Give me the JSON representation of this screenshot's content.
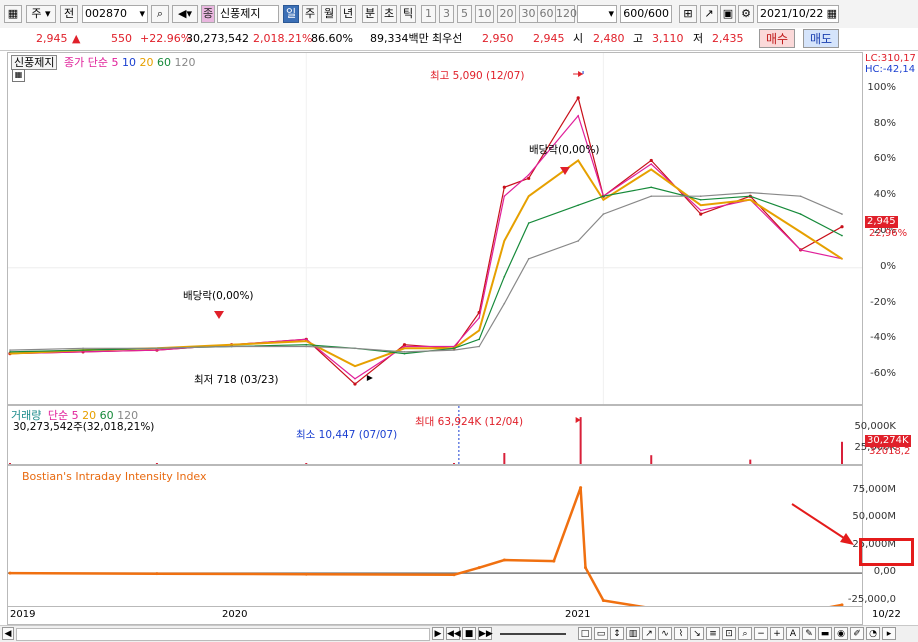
{
  "toolbar": {
    "market_label": "주",
    "prev_label": "전",
    "code": "002870",
    "stock_name": "신풍제지",
    "period_buttons": [
      "일",
      "주",
      "월",
      "년",
      "분",
      "초",
      "틱"
    ],
    "minute_buttons": [
      "1",
      "3",
      "5",
      "10",
      "20",
      "30",
      "60",
      "120"
    ],
    "count_display": "600",
    "count_total": "/600",
    "date": "2021/10/22"
  },
  "quote": {
    "price": "2,945",
    "change_arrow": "▲",
    "change": "550",
    "change_pct": "+22.96%",
    "volume": "30,273,542",
    "volume_pct": "2,018.21%",
    "ratio": "86.60%",
    "amount": "89,334백만",
    "best_label": "최우선",
    "best_ask": "2,950",
    "best_bid": "2,945",
    "open_label": "시",
    "open": "2,480",
    "high_label": "고",
    "high": "3,110",
    "low_label": "저",
    "low": "2,435",
    "buy_label": "매수",
    "sell_label": "매도"
  },
  "price_panel": {
    "title": "신풍제지",
    "legend_prefix": "종가 단순",
    "ma_labels": [
      "5",
      "10",
      "20",
      "60",
      "120"
    ],
    "ma_colors": [
      "#e0209a",
      "#1a3fd0",
      "#e6a000",
      "#168a3a",
      "#888888"
    ],
    "lc_label": "LC:310,17",
    "hc_label": "HC:-42,14",
    "y_ticks": [
      "100%",
      "80%",
      "60%",
      "40%",
      "20%",
      "0%",
      "-20%",
      "-40%",
      "-60%"
    ],
    "price_tag": "2,945",
    "pct_tag": "22,96%",
    "high_annotation": "최고 5,090 (12/07)",
    "low_annotation": "최저 718 (03/23)",
    "dividend1": "배당락(0,00%)",
    "dividend2": "배당락(0,00%)"
  },
  "volume_panel": {
    "title": "거래량",
    "legend_prefix": "단순",
    "ma_labels": [
      "5",
      "20",
      "60",
      "120"
    ],
    "current": "30,273,542주(32,018,21%)",
    "min_annotation": "최소 10,447 (07/07)",
    "max_annotation": "최대 63,924K (12/04)",
    "y_ticks": [
      "50,000K",
      "25,000K"
    ],
    "tag1": "30,274K",
    "tag2": "32018,2"
  },
  "bostian_panel": {
    "title": "Bostian's Intraday Intensity Index",
    "y_ticks": [
      "75,000M",
      "50,000M",
      "25,000M",
      "0,00",
      "-25,000,0"
    ],
    "highlight_value": "0,00"
  },
  "x_axis": {
    "labels": [
      "2019",
      "2020",
      "2021"
    ],
    "end_label": "10/22"
  },
  "chart_data": [
    {
      "type": "line",
      "title": "신풍제지",
      "xlabel": "",
      "ylabel": "",
      "y_unit": "%",
      "ylim": [
        -70,
        110
      ],
      "x": [
        "2019-01",
        "2019-04",
        "2019-07",
        "2019-10",
        "2020-01",
        "2020-03",
        "2020-05",
        "2020-07",
        "2020-08",
        "2020-09",
        "2020-10",
        "2020-12",
        "2021-01",
        "2021-03",
        "2021-05",
        "2021-07",
        "2021-09",
        "2021-10-22"
      ],
      "series": [
        {
          "name": "종가",
          "values": [
            -48,
            -47,
            -46,
            -43,
            -40,
            -65,
            -43,
            -45,
            -25,
            45,
            50,
            95,
            40,
            60,
            30,
            40,
            10,
            22.96
          ]
        },
        {
          "name": "5",
          "values": [
            -48,
            -47,
            -46,
            -43,
            -40,
            -62,
            -44,
            -44,
            -28,
            40,
            52,
            85,
            40,
            58,
            32,
            38,
            10,
            5
          ]
        },
        {
          "name": "20",
          "values": [
            -48,
            -46,
            -45,
            -43,
            -41,
            -55,
            -45,
            -45,
            -35,
            15,
            40,
            60,
            38,
            55,
            35,
            38,
            20,
            5
          ]
        },
        {
          "name": "60",
          "values": [
            -47,
            -46,
            -45,
            -44,
            -43,
            -45,
            -48,
            -45,
            -40,
            -5,
            25,
            35,
            40,
            45,
            38,
            40,
            30,
            18
          ]
        },
        {
          "name": "120",
          "values": [
            -46,
            -45,
            -45,
            -44,
            -44,
            -45,
            -47,
            -46,
            -44,
            -20,
            5,
            15,
            30,
            40,
            40,
            42,
            40,
            30
          ]
        }
      ]
    },
    {
      "type": "bar",
      "title": "거래량",
      "y_unit": "K",
      "ylim": [
        0,
        60000
      ],
      "x": [
        "2019-01",
        "2019-07",
        "2020-01",
        "2020-07",
        "2020-09",
        "2020-12-04",
        "2021-03",
        "2021-07",
        "2021-10-22"
      ],
      "values": [
        500,
        400,
        600,
        10.447,
        15000,
        63924,
        12000,
        6000,
        30274
      ]
    },
    {
      "type": "line",
      "title": "Bostian's Intraday Intensity Index",
      "y_unit": "M",
      "ylim": [
        -30000,
        85000
      ],
      "x": [
        "2019-01",
        "2019-07",
        "2020-01",
        "2020-07",
        "2020-08",
        "2020-09",
        "2020-11",
        "2020-12-04",
        "2020-12-10",
        "2021-01",
        "2021-03",
        "2021-06",
        "2021-09",
        "2021-10-22"
      ],
      "values": [
        0,
        -500,
        -1000,
        -1500,
        5000,
        12000,
        11000,
        78000,
        5000,
        -25000,
        -32000,
        -35000,
        -36000,
        -29000
      ]
    }
  ]
}
